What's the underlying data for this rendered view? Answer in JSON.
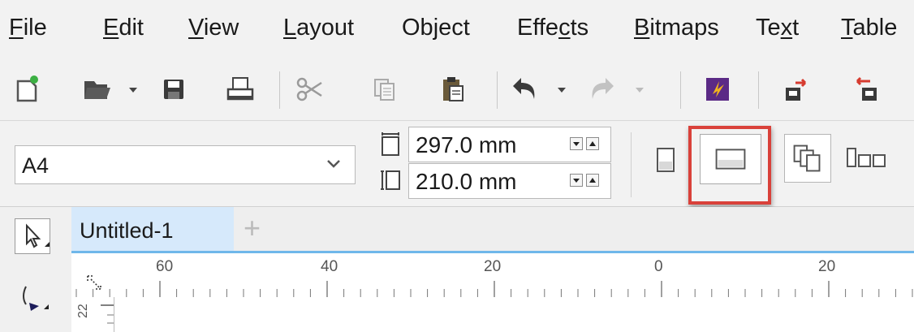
{
  "menu": {
    "items": [
      {
        "key": "file",
        "pre": "",
        "u": "F",
        "post": "ile"
      },
      {
        "key": "edit",
        "pre": "",
        "u": "E",
        "post": "dit"
      },
      {
        "key": "view",
        "pre": "",
        "u": "V",
        "post": "iew"
      },
      {
        "key": "layout",
        "pre": "",
        "u": "L",
        "post": "ayout"
      },
      {
        "key": "object",
        "pre": "Ob",
        "u": "j",
        "post": "ect"
      },
      {
        "key": "effects",
        "pre": "Effe",
        "u": "c",
        "post": "ts"
      },
      {
        "key": "bitmaps",
        "pre": "",
        "u": "B",
        "post": "itmaps"
      },
      {
        "key": "text",
        "pre": "Te",
        "u": "x",
        "post": "t"
      },
      {
        "key": "table",
        "pre": "",
        "u": "T",
        "post": "able"
      }
    ]
  },
  "toolbar": {
    "icons": [
      "new-document-icon",
      "open-folder-icon",
      "save-icon",
      "print-icon",
      "cut-icon",
      "copy-icon",
      "paste-icon",
      "undo-icon",
      "redo-icon",
      "corel-connect-icon",
      "import-icon",
      "export-icon"
    ]
  },
  "propbar": {
    "page_size_preset": "A4",
    "page_width": "297.0 mm",
    "page_height": "210.0 mm"
  },
  "tabs": {
    "document_tab": "Untitled-1",
    "add_tab": "+"
  },
  "ruler": {
    "labels": [
      "60",
      "40",
      "20",
      "0",
      "20"
    ],
    "vertical_label": "22"
  },
  "colors": {
    "highlight": "#d9413a",
    "active_tab": "#d6e9fb",
    "tab_line": "#6fb7ea"
  }
}
